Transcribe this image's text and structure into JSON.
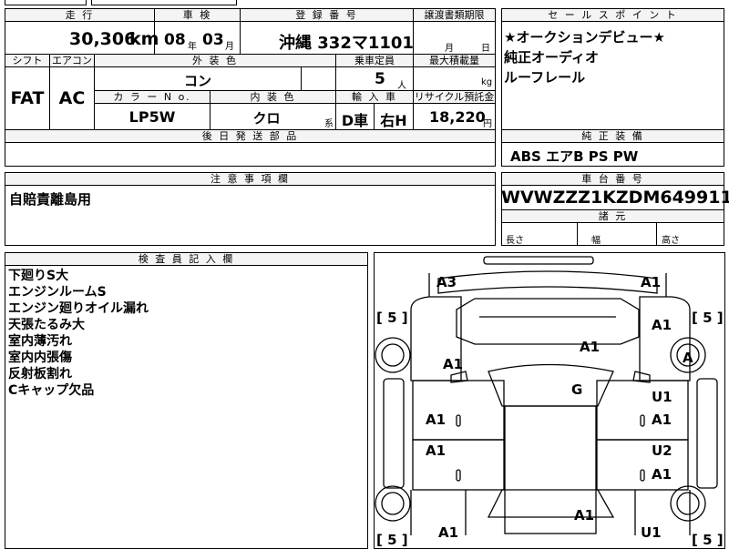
{
  "headers": {
    "mileage": "走 行",
    "inspection": "車 検",
    "registration": "登 録 番 号",
    "transfer_deadline": "譲渡書類期限",
    "sales_point": "セ ー ル ス ポ イ ン ト",
    "shift": "シフト",
    "aircon": "エアコン",
    "exterior_color": "外 装 色",
    "capacity": "乗車定員",
    "max_load": "最大積載量",
    "color_no": "カ ラ ー N o.",
    "interior_color": "内 装 色",
    "import_car": "輸 入 車",
    "recycle_fee": "リサイクル預託金",
    "accessories": "後 日 発 送 部 品",
    "genuine_equipment": "純 正 装 備",
    "notes": "注 意 事 項 欄",
    "chassis_no": "車 台 番 号",
    "dimensions": "諸 元",
    "inspector": "検 査 員 記 入 欄"
  },
  "vehicle": {
    "mileage": "30,306",
    "mileage_unit": "km",
    "inspection_year": "08",
    "inspection_year_unit": "年",
    "inspection_month": "03",
    "inspection_month_unit": "月",
    "plate": "沖縄 332マ1101",
    "deadline_month": "月",
    "deadline_day": "日",
    "shift": "FAT",
    "aircon": "AC",
    "exterior_color": "コン",
    "capacity": "5",
    "capacity_unit": "人",
    "load_unit": "kg",
    "color_no": "LP5W",
    "interior_color": "クロ",
    "interior_suffix": "系",
    "import_type": "D車",
    "steering": "右H",
    "recycle_fee": "18,220",
    "recycle_unit": "円",
    "chassis_no": "WVWZZZ1KZDM649911",
    "dim_length": "長さ",
    "dim_width": "幅",
    "dim_height": "高さ"
  },
  "sales_points": [
    "★オークションデビュー★",
    "純正オーディオ",
    "ルーフレール"
  ],
  "equipment": "ABS エアB PS PW",
  "notes_text": "自賠責離島用",
  "inspector_notes": [
    "下廻りS大",
    "エンジンルームS",
    "エンジン廻りオイル漏れ",
    "天張たるみ大",
    "室内薄汚れ",
    "室内内張傷",
    "反射板割れ",
    "Cキャップ欠品"
  ],
  "diagram": {
    "grades": {
      "front_left_corner": "A3",
      "front_right_corner": "A1",
      "right_front_fender": "A1",
      "hood": "A1",
      "left_front_fender": "A1",
      "right_front_wheel": "A",
      "windshield": "G",
      "right_front_door_top": "U1",
      "right_front_door": "A1",
      "left_front_door": "A1",
      "left_rear_door": "A1",
      "right_rear_door_top": "U2",
      "right_rear_door": "A1",
      "roof_rear": "A1",
      "left_rear": "A1",
      "right_rear": "U1"
    },
    "tires": [
      "[ 5 ]",
      "[ 5 ]",
      "[ 5 ]",
      "[ 5 ]"
    ]
  }
}
